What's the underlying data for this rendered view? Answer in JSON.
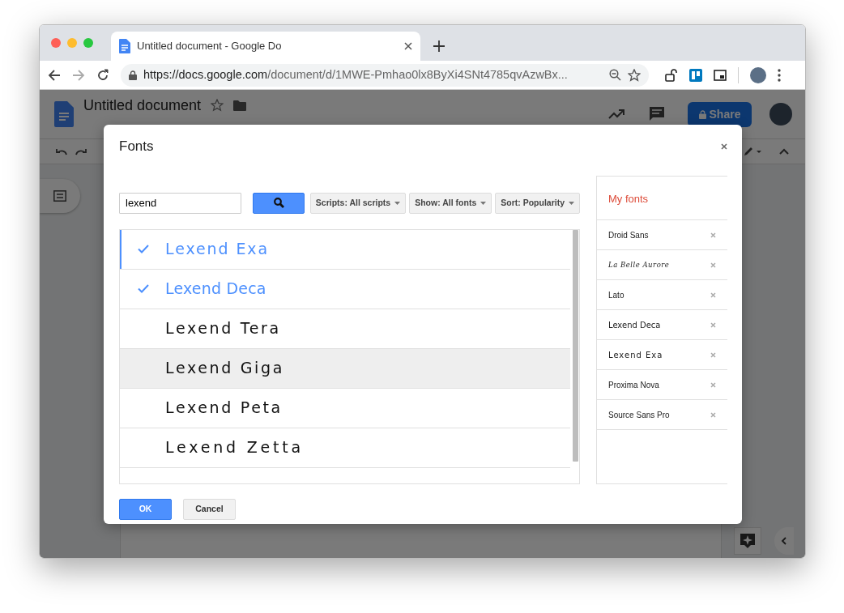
{
  "browser": {
    "tab_title": "Untitled document - Google Do",
    "url_domain": "https://docs.google.com",
    "url_path": "/document/d/1MWE-Pmhao0lx8ByXi4SNt4785qvAzwBx..."
  },
  "document": {
    "title": "Untitled document",
    "share_label": "Share"
  },
  "dialog": {
    "title": "Fonts",
    "search": {
      "value": "lexend"
    },
    "filters": [
      "Scripts: All scripts",
      "Show: All fonts",
      "Sort: Popularity"
    ],
    "results": [
      {
        "name": "Lexend Exa",
        "checked": true,
        "focused": true,
        "highlighted": false,
        "kind": "wide"
      },
      {
        "name": "Lexend Deca",
        "checked": true,
        "focused": false,
        "highlighted": false,
        "kind": "plain"
      },
      {
        "name": "Lexend Tera",
        "checked": false,
        "focused": false,
        "highlighted": false,
        "kind": "wider"
      },
      {
        "name": "Lexend Giga",
        "checked": false,
        "focused": false,
        "highlighted": true,
        "kind": "wider"
      },
      {
        "name": "Lexend Peta",
        "checked": false,
        "focused": false,
        "highlighted": false,
        "kind": "wider"
      },
      {
        "name": "Lexend Zetta",
        "checked": false,
        "focused": false,
        "highlighted": false,
        "kind": "widest"
      }
    ],
    "my_fonts": {
      "title": "My fonts",
      "items": [
        {
          "name": "Droid Sans",
          "kind": "plain"
        },
        {
          "name": "La Belle Aurore",
          "kind": "script"
        },
        {
          "name": "Lato",
          "kind": "plain"
        },
        {
          "name": "Lexend Deca",
          "kind": "bold"
        },
        {
          "name": "Lexend Exa",
          "kind": "wide"
        },
        {
          "name": "Proxima Nova",
          "kind": "plain"
        },
        {
          "name": "Source Sans Pro",
          "kind": "plain"
        }
      ]
    },
    "buttons": [
      {
        "label": "OK",
        "kind": "primary"
      },
      {
        "label": "Cancel",
        "kind": "default"
      }
    ]
  }
}
